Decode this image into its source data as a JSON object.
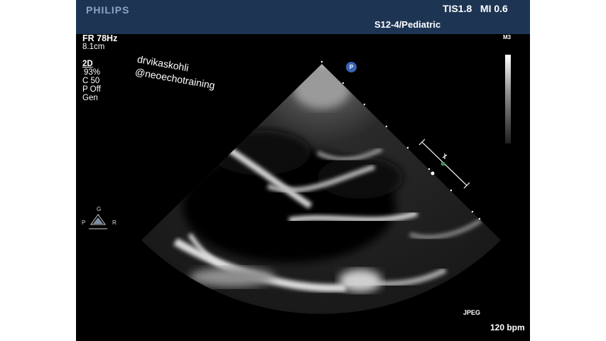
{
  "header": {
    "brand": "PHILIPS",
    "tis_mi": "TIS1.8   MI 0.6",
    "probe_preset": "S12-4/Pediatric"
  },
  "params": {
    "frame_rate": "FR 78Hz",
    "depth": "8.1cm",
    "mode": "2D",
    "gain": "93%",
    "compression": "C 50",
    "persistence": "P Off",
    "frequency": "Gen"
  },
  "watermark": {
    "line1": "drvikaskohli",
    "line2": "@neoechotraining"
  },
  "scale_label": "M3",
  "orientation": {
    "top": "G",
    "left": "P",
    "right": "R"
  },
  "sector_marker": "P",
  "footer": {
    "format": "JPEG",
    "heart_rate": "120 bpm"
  }
}
